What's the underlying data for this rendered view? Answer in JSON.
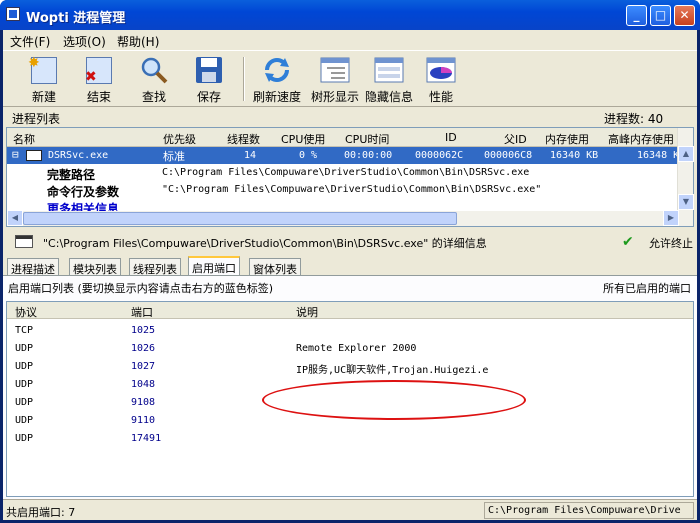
{
  "window": {
    "title": "Wopti 进程管理",
    "minimize": "_",
    "maximize": "□",
    "close": "✕"
  },
  "menu": [
    "文件(F)",
    "选项(O)",
    "帮助(H)"
  ],
  "toolbar": [
    "新建",
    "结束",
    "查找",
    "保存",
    "刷新速度",
    "树形显示",
    "隐藏信息",
    "性能"
  ],
  "process_list": {
    "label": "进程列表",
    "count_label": "进程数: 40",
    "columns": [
      "名称",
      "优先级",
      "线程数",
      "CPU使用",
      "CPU时间",
      "ID",
      "父ID",
      "内存使用",
      "高峰内存使用"
    ],
    "selected_row": {
      "expander": "⊟",
      "name": "DSRSvc.exe",
      "priority": "标准",
      "threads": "14",
      "cpu": "0 %",
      "cpu_time": "00:00:00",
      "id": "0000062C",
      "parent_id": "000006C8",
      "memory": "16340 KB",
      "peak_memory": "16348 K"
    },
    "details": [
      {
        "key": "完整路径",
        "value": "C:\\Program Files\\Compuware\\DriverStudio\\Common\\Bin\\DSRSvc.exe"
      },
      {
        "key": "命令行及参数",
        "value": "\"C:\\Program Files\\Compuware\\DriverStudio\\Common\\Bin\\DSRSvc.exe\""
      },
      {
        "key": "更多相关信息",
        "value": ""
      }
    ]
  },
  "detail_bar": {
    "text": "\"C:\\Program Files\\Compuware\\DriverStudio\\Common\\Bin\\DSRSvc.exe\" 的详细信息",
    "status": "允许终止"
  },
  "tabs": [
    "进程描述",
    "模块列表",
    "线程列表",
    "启用端口",
    "窗体列表"
  ],
  "ports_panel": {
    "hint": "启用端口列表 (要切换显示内容请点击右方的蓝色标签)",
    "right_label": "所有已启用的端口",
    "columns": [
      "协议",
      "端口",
      "说明"
    ],
    "rows": [
      {
        "protocol": "TCP",
        "port": "1025",
        "desc": ""
      },
      {
        "protocol": "UDP",
        "port": "1026",
        "desc": "Remote Explorer 2000"
      },
      {
        "protocol": "UDP",
        "port": "1027",
        "desc": "IP服务,UC聊天软件,Trojan.Huigezi.e"
      },
      {
        "protocol": "UDP",
        "port": "1048",
        "desc": ""
      },
      {
        "protocol": "UDP",
        "port": "9108",
        "desc": ""
      },
      {
        "protocol": "UDP",
        "port": "9110",
        "desc": ""
      },
      {
        "protocol": "UDP",
        "port": "17491",
        "desc": ""
      }
    ]
  },
  "statusbar": {
    "left": "共启用端口: 7",
    "right": "C:\\Program Files\\Compuware\\Drive"
  },
  "colors": {
    "selection": "#316ac5",
    "title_blue": "#0046d5",
    "annotation": "#dd1111"
  }
}
